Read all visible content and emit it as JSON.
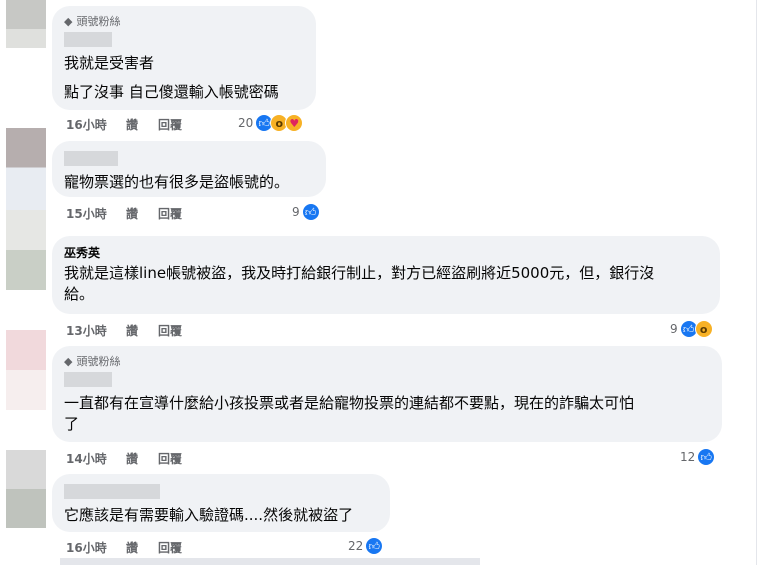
{
  "comments": [
    {
      "badge": "頭號粉絲",
      "name": "",
      "lines": [
        "我就是受害者",
        "點了沒事 自己傻還輸入帳號密碼"
      ],
      "time": "16小時",
      "like_label": "讚",
      "reply_label": "回覆",
      "reaction_count": "20",
      "reactions": [
        "like",
        "wow",
        "care"
      ],
      "avatar_colors": [
        "#c7c8c5",
        "#dfe0dd"
      ]
    },
    {
      "badge": "",
      "name": "",
      "lines": [
        "寵物票選的也有很多是盜帳號的。"
      ],
      "time": "15小時",
      "like_label": "讚",
      "reply_label": "回覆",
      "reaction_count": "9",
      "reactions": [
        "like"
      ],
      "avatar_colors": [
        "#b6aeae",
        "#e8ecf2"
      ]
    },
    {
      "badge": "",
      "name": "巫秀英",
      "lines": [
        "我就是這樣line帳號被盜，我及時打給銀行制止，對方已經盜刷將近5000元，但，銀行沒",
        "給。"
      ],
      "time": "13小時",
      "like_label": "讚",
      "reply_label": "回覆",
      "reaction_count": "9",
      "reactions": [
        "like",
        "wow"
      ],
      "avatar_colors": [
        "#c9cfc6",
        "#dde1db"
      ]
    },
    {
      "badge": "頭號粉絲",
      "name": "",
      "lines": [
        "一直都有在宣導什麼給小孩投票或者是給寵物投票的連結都不要點，現在的詐騙太可怕",
        "了"
      ],
      "time": "14小時",
      "like_label": "讚",
      "reply_label": "回覆",
      "reaction_count": "12",
      "reactions": [
        "like"
      ],
      "avatar_colors": [
        "#f1d9dc",
        "#f6eeee"
      ]
    },
    {
      "badge": "",
      "name": "",
      "lines": [
        "它應該是有需要輸入驗證碼....然後就被盜了"
      ],
      "time": "16小時",
      "like_label": "讚",
      "reply_label": "回覆",
      "reaction_count": "22",
      "reactions": [
        "like"
      ],
      "avatar_colors": [
        "#d9d9d9",
        "#bfc3bd"
      ]
    }
  ],
  "icons": {
    "like": "thumbs-up-icon",
    "wow": "wow-face-icon",
    "care": "care-face-icon",
    "badge": "diamond-icon"
  },
  "colors": {
    "bubble": "#f0f2f5",
    "meta": "#65676b",
    "like": "#1877f2"
  }
}
